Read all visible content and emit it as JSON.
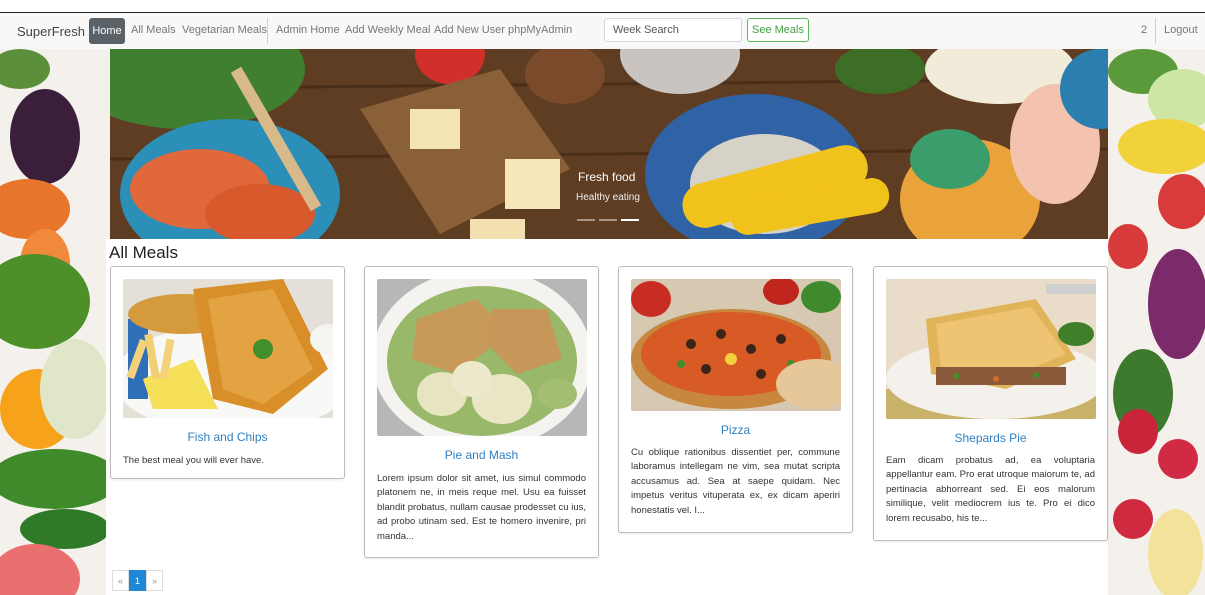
{
  "navbar": {
    "brand": "SuperFresh",
    "home": "Home",
    "links": [
      "All Meals",
      "Vegetarian Meals",
      "Admin Home",
      "Add Weekly Meal",
      "Add New User",
      "phpMyAdmin"
    ],
    "search_value": "Week Search",
    "see_meals": "See Meals",
    "counter": "2",
    "logout": "Logout"
  },
  "hero": {
    "caption_title": "Fresh food",
    "caption_sub": "Healthy eating"
  },
  "page_title": "All Meals",
  "meals": [
    {
      "title": "Fish and Chips",
      "text": "The best meal you will ever have."
    },
    {
      "title": "Pie and Mash",
      "text": "Lorem ipsum dolor sit amet, ius simul commodo platonem ne, in meis reque mel. Usu ea fuisset blandit probatus, nullam causae prodesset cu ius, ad probo utinam sed. Est te homero invenire, pri manda..."
    },
    {
      "title": "Pizza",
      "text": "Cu oblique rationibus dissentiet per, commune laboramus intellegam ne vim, sea mutat scripta accusamus ad. Sea at saepe quidam. Nec impetus veritus vituperata ex, ex dicam aperiri honestatis vel. I..."
    },
    {
      "title": "Shepards Pie",
      "text": "Eam dicam probatus ad, ea voluptaria appellantur eam. Pro erat utroque maiorum te, ad pertinacia abhorreant sed. Ei eos malorum similique, velit mediocrem ius te. Pro ei dico lorem recusabo, his te..."
    }
  ],
  "pagination": {
    "prev": "«",
    "page": "1",
    "next": "»"
  }
}
